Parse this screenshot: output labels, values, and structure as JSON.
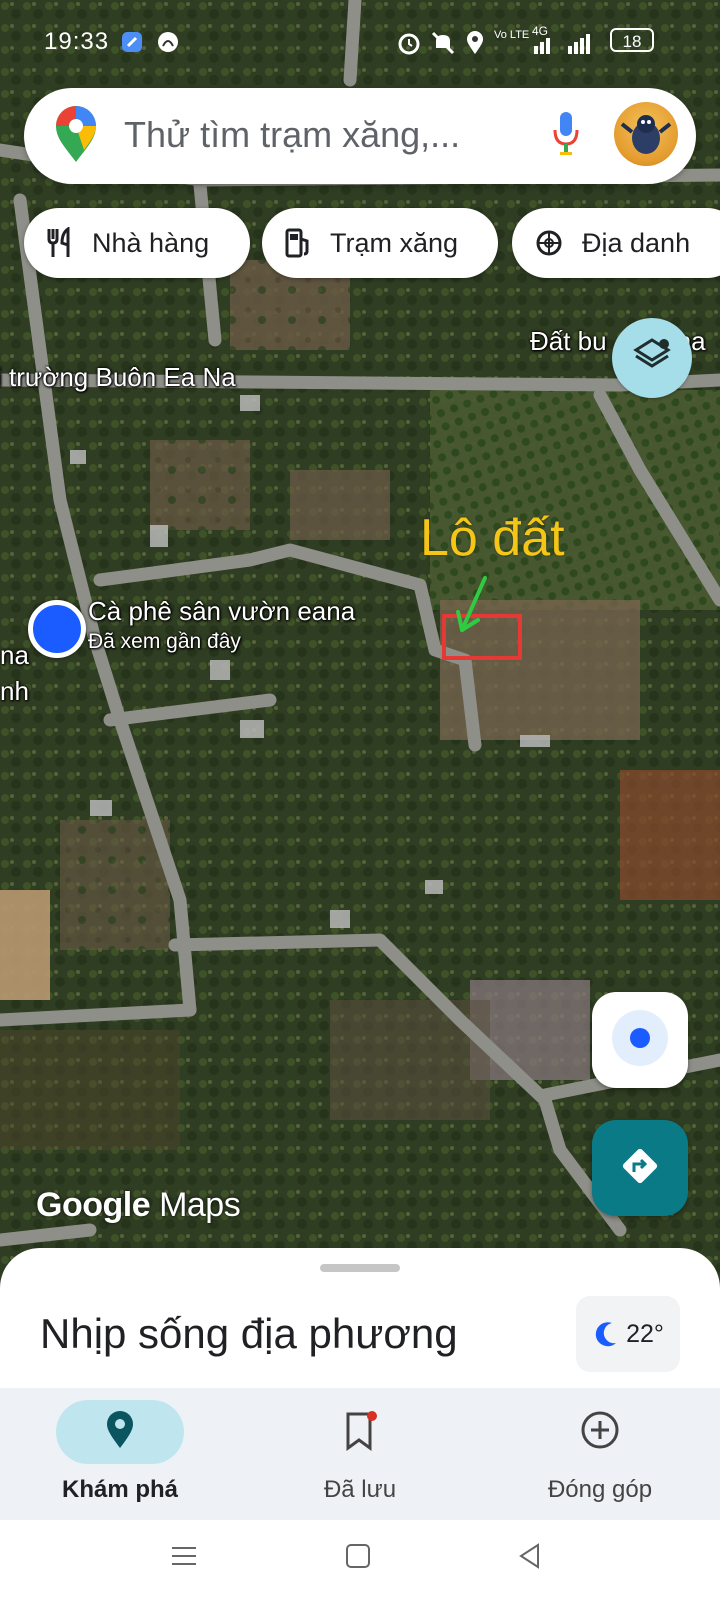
{
  "status_bar": {
    "time": "19:33",
    "battery": "18",
    "network": "4G",
    "volte": "Vo LTE",
    "icons": [
      "browser-icon",
      "app-icon",
      "alarm-icon",
      "mute-icon",
      "location-icon",
      "signal-icon",
      "battery-icon"
    ]
  },
  "search": {
    "placeholder": "Thử tìm trạm xăng,...",
    "icons": [
      "maps-pin-icon",
      "mic-icon",
      "avatar"
    ]
  },
  "chips": [
    {
      "label": "Nhà hàng",
      "icon": "restaurant-icon"
    },
    {
      "label": "Trạm xăng",
      "icon": "gas-station-icon"
    },
    {
      "label": "Địa danh",
      "icon": "landmark-icon"
    }
  ],
  "map_labels": {
    "road": "i trường Buôn Ea Na",
    "top_right": "Đất bu",
    "top_right_suffix": "na",
    "place_name": "Cà phê sân vườn eana",
    "place_sub": "Đã xem gần đây",
    "left_edge_1": "na",
    "left_edge_2": "nh"
  },
  "annotation": {
    "text": "Lô đất",
    "text_color": "#f5c518",
    "box_color": "#e53935",
    "arrow_color": "#2ecc40"
  },
  "logo": {
    "google": "Google",
    "maps": "Maps"
  },
  "sheet": {
    "title": "Nhịp sống địa phương",
    "temperature": "22°",
    "weather_icon": "moon-icon"
  },
  "bottom_nav": [
    {
      "label": "Khám phá",
      "icon": "explore-pin-icon",
      "active": true
    },
    {
      "label": "Đã lưu",
      "icon": "bookmark-icon",
      "active": false,
      "badge": true
    },
    {
      "label": "Đóng góp",
      "icon": "add-circle-icon",
      "active": false
    }
  ],
  "colors": {
    "accent_teal": "#0b7a87",
    "location_blue": "#1a5cff",
    "layers_bg": "#a5dde8",
    "nav_pill": "#bfe6ee"
  }
}
